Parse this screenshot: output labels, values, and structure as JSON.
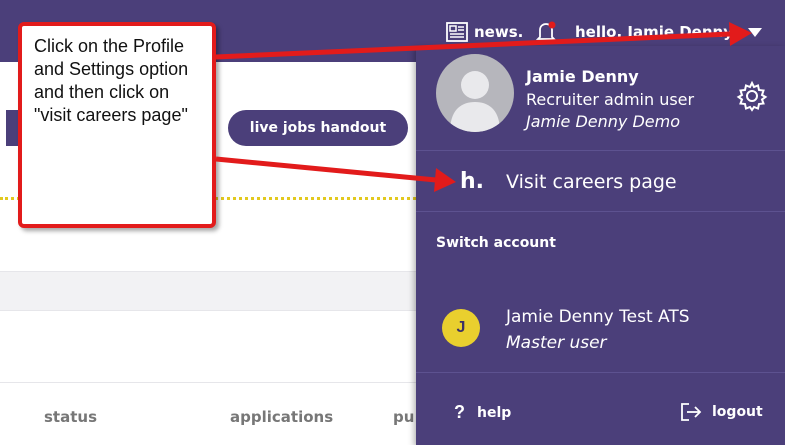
{
  "topbar": {
    "news_label": "news.",
    "user_greeting": "hello, Jamie Denny"
  },
  "background": {
    "live_jobs_button": "live jobs handout",
    "columns": [
      "status",
      "applications",
      "pu"
    ]
  },
  "dropdown": {
    "profile": {
      "name": "Jamie Denny",
      "role": "Recruiter admin user",
      "company": "Jamie Denny Demo"
    },
    "careers_link": "Visit careers page",
    "careers_logo": "h.",
    "switch_account_label": "Switch account",
    "accounts": [
      {
        "initial": "J",
        "name": "Jamie Denny Test ATS",
        "role": "Master user"
      }
    ],
    "help_label": "help",
    "logout_label": "logout"
  },
  "callout": {
    "text": "Click on the Profile and Settings option and then click on \"visit careers page\""
  },
  "colors": {
    "brand_purple": "#4b3f7a",
    "accent_yellow": "#e9cf2e",
    "arrow_red": "#e21b1b"
  }
}
